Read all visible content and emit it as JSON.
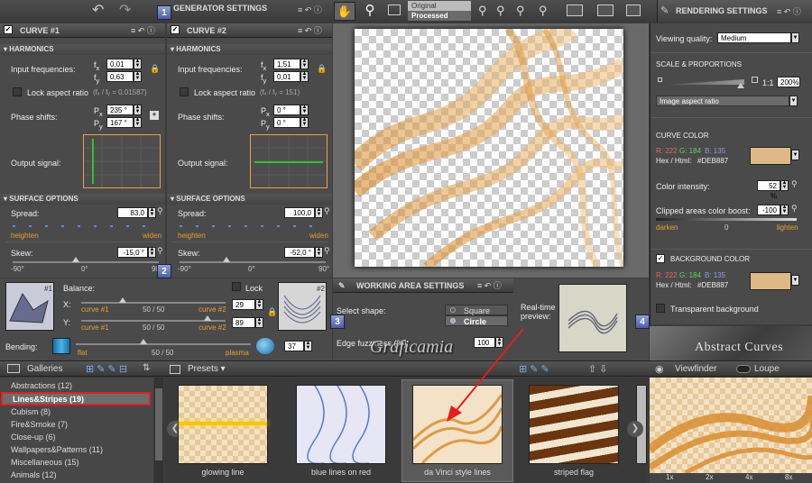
{
  "top": {
    "generator_settings": "GENERATOR SETTINGS",
    "rendering_settings": "RENDERING SETTINGS",
    "original": "Original",
    "processed": "Processed"
  },
  "curve1": {
    "title": "CURVE #1",
    "harmonics": "HARMONICS",
    "input_freq": "Input frequencies:",
    "fx_label": "f",
    "fx_sub": "x",
    "fx": "0,01",
    "fy_label": "f",
    "fy_sub": "y",
    "fy": "0,63",
    "lock_aspect": "Lock aspect ratio",
    "ratio": "(fₓ / fᵧ = 0.01587)",
    "phase": "Phase shifts:",
    "px_label": "P",
    "px_sub": "x",
    "px": "235 °",
    "py_label": "P",
    "py_sub": "y",
    "py": "167 °",
    "output": "Output signal:",
    "surface": "SURFACE OPTIONS",
    "spread": "Spread:",
    "spread_val": "83,0",
    "heighten": "heighten",
    "widen": "widen",
    "skew": "Skew:",
    "skew_val": "-15,0 °",
    "m90": "-90°",
    "zero": "0°",
    "p90": "90°"
  },
  "curve2": {
    "title": "CURVE #2",
    "harmonics": "HARMONICS",
    "input_freq": "Input frequencies:",
    "fx_label": "f",
    "fx_sub": "x",
    "fx": "1,51",
    "fy_label": "f",
    "fy_sub": "y",
    "fy": "0,01",
    "lock_aspect": "Lock aspect ratio",
    "ratio": "(fₓ / fᵧ = 151)",
    "phase": "Phase shifts:",
    "px_label": "P",
    "px_sub": "x",
    "px": "0 °",
    "py_label": "P",
    "py_sub": "y",
    "py": "0 °",
    "output": "Output signal:",
    "surface": "SURFACE OPTIONS",
    "spread": "Spread:",
    "spread_val": "100,0",
    "heighten": "heighten",
    "widen": "widen",
    "skew": "Skew:",
    "skew_val": "-52,0 °",
    "m90": "-90°",
    "zero": "0°",
    "p90": "90°"
  },
  "balance": {
    "title": "Balance:",
    "lock": "Lock",
    "x": "X:",
    "y": "Y:",
    "c1": "curve #1",
    "c2": "curve #2",
    "mid": "50 / 50",
    "x_val": "29",
    "y_val": "89",
    "thumb1": "#1",
    "thumb2": "#2"
  },
  "bending": {
    "label": "Bending:",
    "flat": "flat",
    "mid": "50 / 50",
    "plasma": "plasma",
    "value": "37"
  },
  "working": {
    "title": "WORKING AREA SETTINGS",
    "select_shape": "Select shape:",
    "square": "Square",
    "circle": "Circle",
    "realtime": "Real-time preview:",
    "edge": "Edge fuzziness (%):",
    "edge_val": "100"
  },
  "rendering": {
    "viewing_quality": "Viewing quality:",
    "quality": "Medium",
    "scale": "SCALE & PROPORTIONS",
    "ratio11": "1:1",
    "zoom": "200%",
    "aspect_opt": "Image aspect ratio",
    "curve_color": "CURVE COLOR",
    "r": "R: 222",
    "g": "G: 184",
    "b": "B: 135",
    "hex_lbl": "Hex / Html:",
    "hex": "#DEB887",
    "swatch": "#DEB887",
    "intensity": "Color intensity:",
    "intensity_val": "52 %",
    "clipped": "Clipped areas color boost:",
    "clipped_val": "-100",
    "darken": "darken",
    "zero": "0",
    "lighten": "lighten",
    "bg_color": "BACKGROUND COLOR",
    "bg_r": "R: 222",
    "bg_g": "G: 184",
    "bg_b": "B: 135",
    "bg_hex_lbl": "Hex / Html:",
    "bg_hex": "#DEB887",
    "transparent": "Transparent background"
  },
  "logo": "Abstract Curves",
  "watermark": "Graficamia",
  "badges": [
    "1",
    "2",
    "3",
    "4"
  ],
  "galleries": {
    "title": "Galleries",
    "items": [
      {
        "label": "Abstractions (12)"
      },
      {
        "label": "Lines&Stripes (19)"
      },
      {
        "label": "Cubism (8)"
      },
      {
        "label": "Fire&Smoke (7)"
      },
      {
        "label": "Close-up (6)"
      },
      {
        "label": "Wallpapers&Patterns (11)"
      },
      {
        "label": "Miscellaneous (15)"
      },
      {
        "label": "Animals (12)"
      }
    ]
  },
  "presets": {
    "title": "Presets",
    "items": [
      {
        "label": "glowing line"
      },
      {
        "label": "blue lines on red"
      },
      {
        "label": "da Vinci style lines"
      },
      {
        "label": "striped flag"
      }
    ]
  },
  "viewfinder": {
    "title": "Viewfinder",
    "loupe": "Loupe",
    "zooms": [
      "1x",
      "2x",
      "4x",
      "8x"
    ]
  }
}
